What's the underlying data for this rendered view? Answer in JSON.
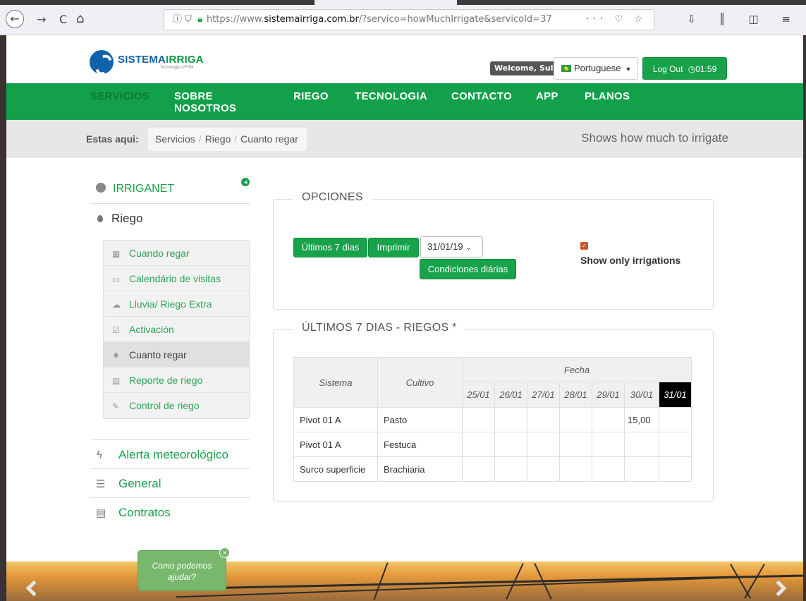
{
  "browser": {
    "url_prefix": "https://www.",
    "url_domain": "sistemairriga.com.br",
    "url_rest": "/?servico=howMuchIrrigate&servicoId=37",
    "nav_back": "←",
    "nav_forward": "→",
    "nav_reload": "C",
    "nav_home": "⌂",
    "url_icons": "··· ♡ ☆",
    "toolbar_icons": "⇩ ║ ◫ ≡"
  },
  "header": {
    "brand_main": "SISTEMA",
    "brand_accent": "IRRIGA",
    "brand_sub": "Tecnologia UFSM",
    "welcome": "Welcome, Sul",
    "language": "Portuguese",
    "logout_label": "Log Out",
    "timer": "01:59"
  },
  "nav": {
    "items": [
      "SERVICIOS",
      "SOBRE NOSOTROS",
      "RIEGO",
      "TECNOLOGIA",
      "CONTACTO",
      "APP",
      "PLANOS"
    ],
    "sobre_1": "SOBRE",
    "sobre_2": "NOSOTROS"
  },
  "breadcrumb": {
    "label": "Estas aqui:",
    "items": [
      "Servicios",
      "Riego",
      "Cuanto regar"
    ],
    "right_text": "Shows how much to irrigate"
  },
  "sidebar": {
    "irriganet": "IRRIGANET",
    "riego": "Riego",
    "sub_items": [
      {
        "label": "Cuando regar",
        "icon": "calendar-icon"
      },
      {
        "label": "Calendário de visitas",
        "icon": "calendar-empty-icon"
      },
      {
        "label": "Lluvia/ Riego Extra",
        "icon": "cloud-icon"
      },
      {
        "label": "Activación",
        "icon": "checkbox-icon"
      },
      {
        "label": "Cuanto regar",
        "icon": "drop-icon"
      },
      {
        "label": "Reporte de riego",
        "icon": "document-icon"
      },
      {
        "label": "Control de riego",
        "icon": "edit-icon"
      }
    ],
    "lower_items": [
      "Alerta meteorológico",
      "General",
      "Contratos"
    ]
  },
  "options": {
    "title": "OPCIONES",
    "btn_last7": "Últimos 7 dias",
    "btn_print": "Imprimir",
    "date_value": "31/01/19",
    "btn_conditions": "Condiciones diárias",
    "show_only": "Show only irrigations"
  },
  "riegos": {
    "title": "ÚLTIMOS 7 DIAS - RIEGOS *",
    "col_sistema": "Sistema",
    "col_cultivo": "Cultivo",
    "col_fecha": "Fecha",
    "days": [
      "25/01",
      "26/01",
      "27/01",
      "28/01",
      "29/01",
      "30/01",
      "31/01"
    ],
    "rows": [
      {
        "sistema": "Pivot 01 A",
        "cultivo": "Pasto",
        "values": [
          "",
          "",
          "",
          "",
          "",
          "15,00",
          ""
        ]
      },
      {
        "sistema": "Pivot 01 A",
        "cultivo": "Festuca",
        "values": [
          "",
          "",
          "",
          "",
          "",
          "",
          ""
        ]
      },
      {
        "sistema": "Surco superficie",
        "cultivo": "Brachiaria",
        "values": [
          "",
          "",
          "",
          "",
          "",
          "",
          ""
        ]
      }
    ]
  },
  "chat": {
    "line1": "Como podemos",
    "line2": "ajudar?",
    "close": "×"
  },
  "colors": {
    "brand_green": "#12a04a",
    "brand_blue": "#0d62a8",
    "check_orange": "#c45b2a"
  }
}
